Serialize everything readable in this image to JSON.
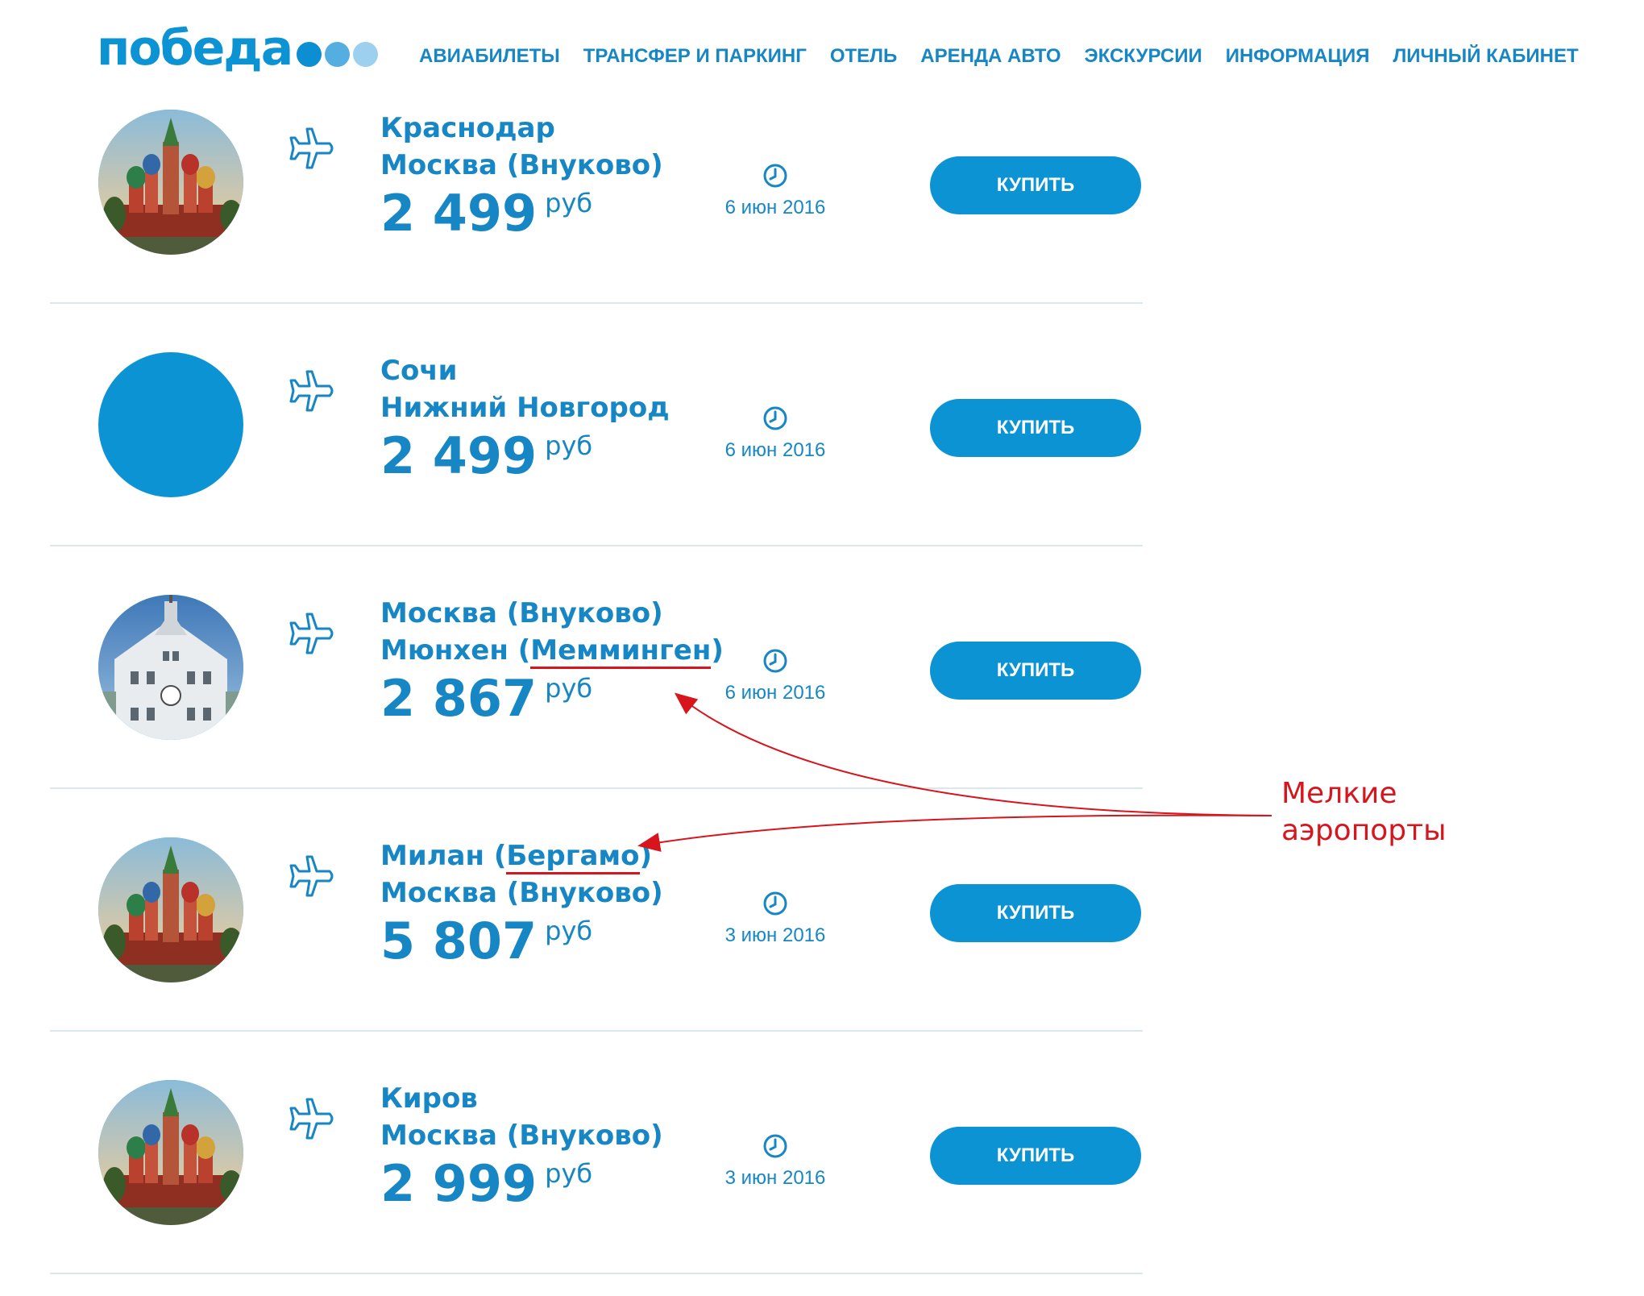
{
  "header": {
    "logo_text": "победа",
    "nav": [
      "АВИАБИЛЕТЫ",
      "ТРАНСФЕР И ПАРКИНГ",
      "ОТЕЛЬ",
      "АРЕНДА АВТО",
      "ЭКСКУРСИИ",
      "ИНФОРМАЦИЯ",
      "ЛИЧНЫЙ КАБИНЕТ"
    ]
  },
  "colors": {
    "brand_blue": "#0b93d3",
    "text_blue": "#1786c5",
    "annotation_red": "#d6151d"
  },
  "currency": "руб",
  "buy_label": "КУПИТЬ",
  "flights": [
    {
      "from": "Краснодар",
      "to_prefix": "Москва (Внуково)",
      "price": "2 499",
      "date": "6 июн 2016",
      "image": "st-basils-cathedral"
    },
    {
      "from": "Сочи",
      "to_prefix": "Нижний Новгород",
      "price": "2 499",
      "date": "6 июн 2016",
      "image": "placeholder-blue"
    },
    {
      "from": "Москва (Внуково)",
      "to_prefix": "Мюнхен (",
      "to_airport": "Мемминген",
      "to_suffix": ")",
      "price": "2 867",
      "date": "6 июн 2016",
      "image": "memmingen-building"
    },
    {
      "from_prefix": "Милан (",
      "from_airport": "Бергамо",
      "from_suffix": ")",
      "to_prefix": "Москва (Внуково)",
      "price": "5 807",
      "date": "3 июн 2016",
      "image": "st-basils-cathedral"
    },
    {
      "from": "Киров",
      "to_prefix": "Москва (Внуково)",
      "price": "2 999",
      "date": "3 июн 2016",
      "image": "st-basils-cathedral"
    }
  ],
  "annotation": {
    "line1": "Мелкие",
    "line2": "аэропорты"
  }
}
